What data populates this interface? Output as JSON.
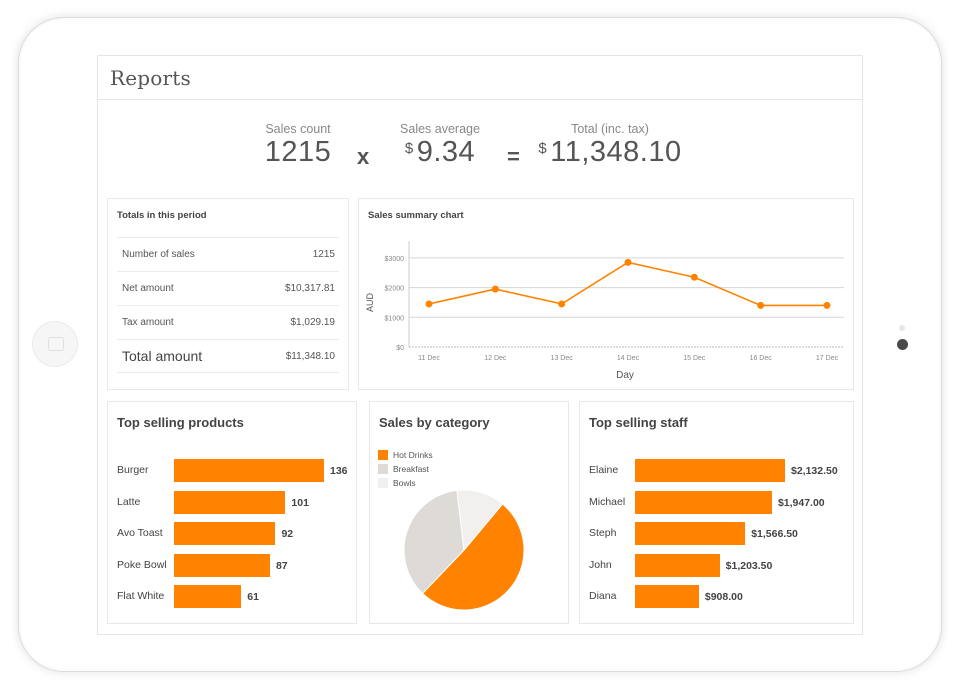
{
  "header": {
    "title": "Reports"
  },
  "summary": {
    "count_label": "Sales count",
    "count_value": "1215",
    "times_op": "x",
    "avg_label": "Sales average",
    "avg_currency": "$",
    "avg_value": "9.34",
    "equals_op": "=",
    "total_label": "Total (inc. tax)",
    "total_currency": "$",
    "total_value": "11,348.10"
  },
  "totals": {
    "title": "Totals in this period",
    "rows": [
      {
        "label": "Number of sales",
        "value": "1215"
      },
      {
        "label": "Net amount",
        "value": "$10,317.81"
      },
      {
        "label": "Tax amount",
        "value": "$1,029.19"
      },
      {
        "label": "Total amount",
        "value": "$11,348.10"
      }
    ]
  },
  "colors": {
    "accent": "#ff8300",
    "breakfast": "#dedbd7",
    "bowls": "#f1f0ee",
    "grid": "#d6d6d6"
  },
  "chart_data": [
    {
      "type": "line",
      "title": "Sales summary chart",
      "xlabel": "Day",
      "ylabel": "AUD",
      "categories": [
        "11 Dec",
        "12 Dec",
        "13 Dec",
        "14 Dec",
        "15 Dec",
        "16 Dec",
        "17 Dec"
      ],
      "values": [
        1450,
        1950,
        1450,
        2850,
        2350,
        1400,
        1400
      ],
      "yticks": [
        0,
        1000,
        2000,
        3000
      ],
      "ytick_labels": [
        "$0",
        "$1000",
        "$2000",
        "$3000"
      ],
      "ylim": [
        0,
        3300
      ],
      "grid": true
    },
    {
      "type": "bar",
      "orientation": "horizontal",
      "title": "Top selling products",
      "categories": [
        "Burger",
        "Latte",
        "Avo Toast",
        "Poke Bowl",
        "Flat White"
      ],
      "values": [
        136,
        101,
        92,
        87,
        61
      ],
      "value_labels": [
        "136",
        "101",
        "92",
        "87",
        "61"
      ]
    },
    {
      "type": "pie",
      "title": "Sales by category",
      "categories": [
        "Hot Drinks",
        "Breakfast",
        "Bowls"
      ],
      "values": [
        51,
        36,
        13
      ],
      "legend": "top-left"
    },
    {
      "type": "bar",
      "orientation": "horizontal",
      "title": "Top selling staff",
      "categories": [
        "Elaine",
        "Michael",
        "Steph",
        "John",
        "Diana"
      ],
      "values": [
        2132.5,
        1947.0,
        1566.5,
        1203.5,
        908.0
      ],
      "value_labels": [
        "$2,132.50",
        "$1,947.00",
        "$1,566.50",
        "$1,203.50",
        "$908.00"
      ]
    }
  ]
}
